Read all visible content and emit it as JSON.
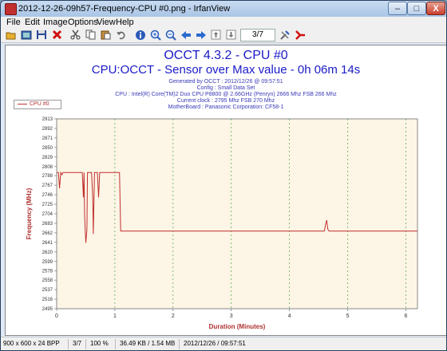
{
  "window": {
    "title": "2012-12-26-09h57-Frequency-CPU #0.png - IrfanView",
    "minimize": "–",
    "maximize": "□",
    "close": "X"
  },
  "menu": [
    "File",
    "Edit",
    "Image",
    "Options",
    "View",
    "Help"
  ],
  "toolbar": {
    "page_indicator": "3/7",
    "icons": [
      "open-icon",
      "thumbnails-icon",
      "save-icon",
      "delete-icon",
      "cut-icon",
      "copy-icon",
      "paste-icon",
      "undo-icon",
      "info-icon",
      "zoom-in-icon",
      "zoom-out-icon",
      "prev-icon",
      "next-icon",
      "first-page-icon",
      "last-page-icon",
      "settings-icon",
      "exit-icon"
    ]
  },
  "report": {
    "title": "OCCT 4.3.2 - CPU #0",
    "subtitle": "CPU:OCCT - Sensor over Max value - 0h 06m 14s",
    "lines": [
      "Generated by OCCT : 2012/12/26 @ 09:57:51",
      "Config : Small Data Set",
      "CPU : Intel(R) Core(TM)2 Duo CPU P8800 @ 2.66GHz (Penryn) 2666 Mhz FSB 266 Mhz",
      "Current clock : 2795 Mhz FSB 270 Mhz",
      "MotherBoard : Panasonic Corporation: CF58-1"
    ]
  },
  "colors": {
    "accent": "#1a1ac8",
    "series": "#c03030",
    "plot_bg": "#fdf5e6"
  },
  "chart_data": {
    "type": "line",
    "xlabel": "Duration (Minutes)",
    "ylabel": "Frequency (MHz)",
    "xlim": [
      0,
      6.2
    ],
    "ylim": [
      2495,
      2913
    ],
    "xticks": [
      0,
      1,
      2,
      3,
      4,
      5,
      6
    ],
    "yticks": [
      2495,
      2516,
      2537,
      2558,
      2578,
      2599,
      2620,
      2641,
      2662,
      2683,
      2704,
      2725,
      2746,
      2767,
      2788,
      2808,
      2829,
      2850,
      2871,
      2892,
      2913
    ],
    "ytick_labels": [
      "2495",
      "2516",
      "2537",
      "2558",
      "2578",
      "2599",
      "2620",
      "2641",
      "2662",
      "2683",
      "2704",
      "2725",
      "2746",
      "2767",
      "2788",
      "2808",
      "2829",
      "2850",
      "2871",
      "2892",
      "2913"
    ],
    "xtick_labels": [
      "0",
      "1",
      "2",
      "3",
      "4",
      "5",
      "6"
    ],
    "grid": true,
    "legend": "top-left",
    "series": [
      {
        "name": "CPU #0",
        "x": [
          0,
          0.03,
          0.05,
          0.07,
          0.09,
          0.11,
          0.13,
          0.16,
          0.2,
          0.25,
          0.3,
          0.35,
          0.4,
          0.44,
          0.46,
          0.47,
          0.48,
          0.5,
          0.52,
          0.53,
          0.55,
          0.57,
          0.6,
          0.62,
          0.63,
          0.65,
          0.68,
          0.7,
          0.72,
          0.74,
          0.76,
          0.78,
          0.8,
          0.83,
          0.87,
          0.9,
          0.93,
          0.95,
          0.97,
          1.0,
          1.02,
          1.04,
          1.06,
          1.08,
          1.1,
          1.5,
          2.0,
          2.5,
          3.0,
          3.5,
          4.0,
          4.5,
          4.6,
          4.62,
          4.64,
          4.66,
          4.68,
          4.72,
          5.0,
          5.5,
          6.0,
          6.2
        ],
        "values": [
          2795,
          2795,
          2760,
          2795,
          2790,
          2795,
          2795,
          2795,
          2795,
          2795,
          2795,
          2795,
          2795,
          2795,
          2740,
          2795,
          2700,
          2640,
          2670,
          2795,
          2795,
          2795,
          2795,
          2740,
          2660,
          2795,
          2795,
          2795,
          2740,
          2795,
          2795,
          2795,
          2795,
          2795,
          2795,
          2795,
          2795,
          2795,
          2795,
          2795,
          2795,
          2795,
          2795,
          2795,
          2666,
          2666,
          2666,
          2666,
          2666,
          2666,
          2666,
          2666,
          2666,
          2680,
          2690,
          2670,
          2666,
          2666,
          2666,
          2666,
          2666,
          2666
        ]
      }
    ]
  },
  "status": {
    "dimensions": "900 x 600 x 24 BPP",
    "page": "3/7",
    "zoom": "100 %",
    "filesize": "36.49 KB / 1.54 MB",
    "datetime": "2012/12/26 / 09:57:51"
  }
}
